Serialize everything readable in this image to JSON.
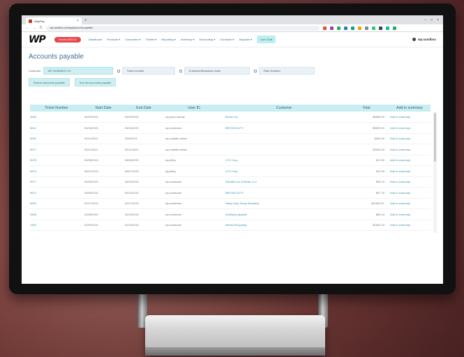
{
  "browser": {
    "tab_title": "WayPay",
    "url": "wp.sandbox.com/app/accounts-payable",
    "tab_close": "×",
    "new_tab": "+",
    "window_controls": [
      "–",
      "□",
      "×"
    ],
    "nav_back": "←",
    "nav_forward": "→",
    "nav_reload": "C",
    "extension_colors": [
      "#e74c3c",
      "#8e44ad",
      "#27ae60",
      "#2980b9",
      "#16a085",
      "#f39c12",
      "#7f8c8d",
      "#2ecc71",
      "#34495e",
      "#1abc9c",
      "#27ae60"
    ]
  },
  "app": {
    "logo": "WP",
    "version_badge": "Version 2023.12",
    "nav": [
      "Dashboard",
      "Products ▾",
      "Customers ▾",
      "Tickets ▾",
      "Reporting ▾",
      "Inventory ▾",
      "Accounting ▾",
      "Contracts ▾",
      "Dispatch ▾"
    ],
    "live_label": "Live Chat",
    "user": "wp.sandbox"
  },
  "page": {
    "title": "Accounts payable"
  },
  "search": {
    "customer_label": "Customer:",
    "customer_value": "WP-SANDBOX-01",
    "ticket_placeholder": "Ticket number",
    "business_placeholder": "Customer/Business name",
    "plate_placeholder": "Plate Number",
    "btn_search": "Search accounts payable",
    "btn_list": "See list accounts payable"
  },
  "table": {
    "columns": [
      "Ticket Number",
      "Start Date",
      "End Date",
      "User ID",
      "Customer",
      "Total",
      "Add to summary"
    ],
    "rows": [
      [
        "5589",
        "05/03/2021",
        "05/03/2021",
        "wp.jason.doedy",
        "Brown Inc",
        "$8658.00",
        "Add to summary"
      ],
      [
        "5611",
        "05/18/2021",
        "05/18/2021",
        "wp.scalesoer",
        "BRYON DUTY",
        "$5825.00",
        "Add to summary"
      ],
      [
        "5592",
        "05/11/2021",
        "05/5/2021",
        "wp.maddie.admin",
        "",
        "$500.00",
        "Add to summary"
      ],
      [
        "5577",
        "05/11/2021",
        "05/11/2021",
        "wp.maddie.admin",
        "",
        "$3300.00",
        "Add to summary"
      ],
      [
        "5578",
        "06/08/2021",
        "06/08/2021",
        "wp.jrilley",
        "XYZ Corp",
        "$12.50",
        "Add to summary"
      ],
      [
        "5674",
        "06/07/2021",
        "06/07/2021",
        "wp.jrilley",
        "XYZ Corp",
        "$11.50",
        "Add to summary"
      ],
      [
        "5577",
        "05/05/2021",
        "05/15/2021",
        "wp.scalesoer",
        "DeKalb Iron & Metal, LLC",
        "$35.15",
        "Add to summary"
      ],
      [
        "5572",
        "05/05/2021",
        "05/15/2021",
        "wp.scalesoer",
        "BRYON DUTY",
        "$97.78",
        "Add to summary"
      ],
      [
        "8533",
        "02/17/2021",
        "02/17/2021",
        "wp.scalesoer",
        "Stacy Duty Scrap Business",
        "$31663.87",
        "Add to summary"
      ],
      [
        "9465",
        "02/06/2021",
        "02/10/2021",
        "wp.scalesoer",
        "Ameliarty Applied",
        "$84.44",
        "Add to summary"
      ],
      [
        "1463",
        "02/09/2021",
        "02/19/2021",
        "wp.scalesoer",
        "Meeks Recycling",
        "$1663.44",
        "Add to summary"
      ]
    ]
  }
}
